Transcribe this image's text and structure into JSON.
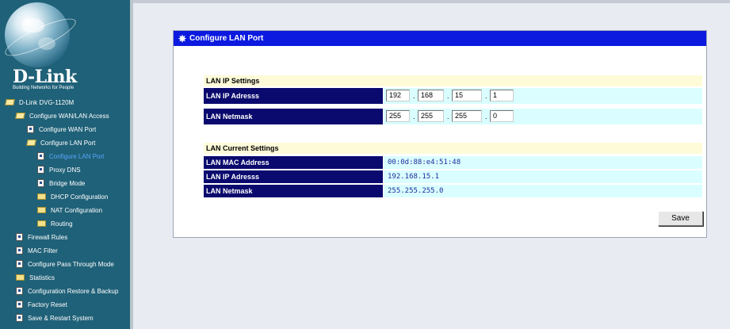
{
  "brand": {
    "name": "D-Link",
    "tagline": "Building Networks for People"
  },
  "sidebar": {
    "items": [
      {
        "label": "D-Link DVG-1120M",
        "icon": "folder-open-icon",
        "active": false
      },
      {
        "label": "Configure WAN/LAN Access",
        "icon": "folder-open-icon",
        "active": false
      },
      {
        "label": "Configure WAN Port",
        "icon": "page-icon",
        "active": false
      },
      {
        "label": "Configure LAN Port",
        "icon": "folder-open-icon",
        "active": false
      },
      {
        "label": "Configure LAN Port",
        "icon": "page-icon",
        "active": true
      },
      {
        "label": "Proxy DNS",
        "icon": "page-icon",
        "active": false
      },
      {
        "label": "Bridge Mode",
        "icon": "page-icon",
        "active": false
      },
      {
        "label": "DHCP Configuration",
        "icon": "folder-icon",
        "active": false
      },
      {
        "label": "NAT Configuration",
        "icon": "folder-icon",
        "active": false
      },
      {
        "label": "Routing",
        "icon": "folder-icon",
        "active": false
      },
      {
        "label": "Firewall Rules",
        "icon": "page-icon",
        "active": false
      },
      {
        "label": "MAC Filter",
        "icon": "page-icon",
        "active": false
      },
      {
        "label": "Configure Pass Through Mode",
        "icon": "page-icon",
        "active": false
      },
      {
        "label": "Statistics",
        "icon": "folder-icon",
        "active": false
      },
      {
        "label": "Configuration Restore & Backup",
        "icon": "page-icon",
        "active": false
      },
      {
        "label": "Factory Reset",
        "icon": "page-icon",
        "active": false
      },
      {
        "label": "Save & Restart System",
        "icon": "page-icon",
        "active": false
      }
    ]
  },
  "panel": {
    "title": "Configure LAN Port",
    "icon": "gear-icon",
    "ip_settings": {
      "heading": "LAN IP Settings",
      "ip_label": "LAN IP Adresss",
      "ip_octets": [
        "192",
        "168",
        "15",
        "1"
      ],
      "mask_label": "LAN Netmask",
      "mask_octets": [
        "255",
        "255",
        "255",
        "0"
      ],
      "separator": "."
    },
    "current": {
      "heading": "LAN Current Settings",
      "rows": [
        {
          "label": "LAN MAC Address",
          "value": "00:0d:88:e4:51:48"
        },
        {
          "label": "LAN IP Adresss",
          "value": "192.168.15.1"
        },
        {
          "label": "LAN Netmask",
          "value": "255.255.255.0"
        }
      ]
    },
    "save_label": "Save"
  },
  "colors": {
    "sidebar_bg": "#1f6178",
    "header_bg": "#0c1ae0",
    "label_bg": "#0a0a6e",
    "value_bg": "#dafeff",
    "section_bg": "#fefbd9",
    "active_link": "#5aa7ff"
  }
}
